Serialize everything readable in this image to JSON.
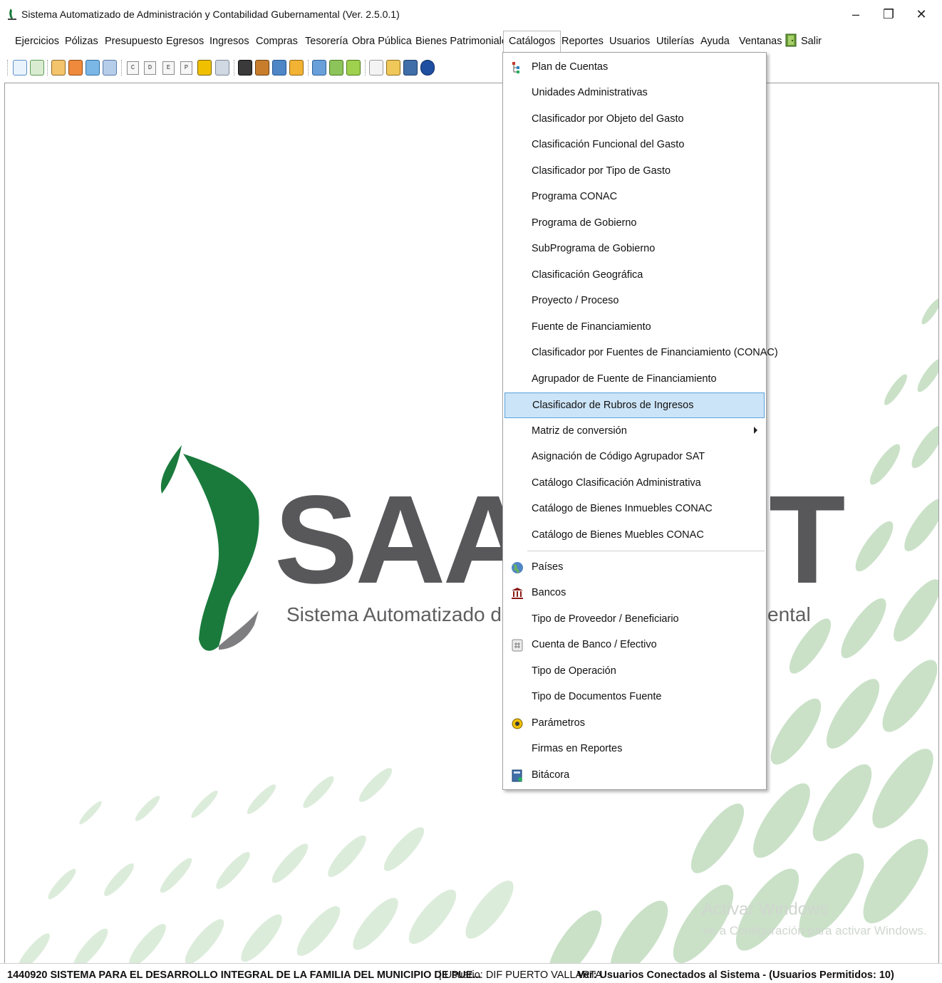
{
  "window": {
    "title": "Sistema Automatizado de Administración y Contabilidad Gubernamental  (Ver. 2.5.0.1)",
    "controls": {
      "minimize": "–",
      "maximize": "❐",
      "close": "✕"
    }
  },
  "menubar": {
    "items": [
      "Ejercicios",
      "Pólizas",
      "Presupuesto",
      "Egresos",
      "Ingresos",
      "Compras",
      "Tesorería",
      "Obra Pública",
      "Bienes Patrimoniales",
      "Catálogos",
      "Reportes",
      "Usuarios",
      "Utilerías",
      "Ayuda",
      "Ventanas",
      "Salir"
    ],
    "open_menu": "Catálogos"
  },
  "toolbar": {
    "letter_buttons": [
      "C",
      "D",
      "E",
      "P"
    ]
  },
  "catalogos_menu": {
    "items": [
      "Plan de Cuentas",
      "Unidades Administrativas",
      "Clasificador por Objeto del Gasto",
      "Clasificación Funcional del Gasto",
      "Clasificador por Tipo de Gasto",
      "Programa CONAC",
      "Programa de Gobierno",
      "SubPrograma de Gobierno",
      "Clasificación Geográfica",
      "Proyecto / Proceso",
      "Fuente de Financiamiento",
      "Clasificador por Fuentes de Financiamiento (CONAC)",
      "Agrupador de Fuente de Financiamiento",
      "Clasificador de Rubros de Ingresos",
      "Matriz de conversión",
      "Asignación de Código Agrupador SAT",
      "Catálogo Clasificación Administrativa",
      "Catálogo de Bienes Inmuebles CONAC",
      "Catálogo de Bienes Muebles CONAC",
      "Países",
      "Bancos",
      "Tipo de Proveedor / Beneficiario",
      "Cuenta de Banco / Efectivo",
      "Tipo de Operación",
      "Tipo de Documentos Fuente",
      "Parámetros",
      "Firmas en Reportes",
      "Bitácora"
    ],
    "selected": "Clasificador de Rubros de Ingresos",
    "submenu_item": "Matriz de conversión",
    "highlight_color": "#cce4f7"
  },
  "splash": {
    "logo_text_left": "SAAC",
    "logo_text_right": "T",
    "subtitle_left": "Sistema Automatizado de Adm",
    "subtitle_right": "ental",
    "brand_green": "#1a7a3c"
  },
  "watermark": {
    "title": "Activar Windows",
    "subtitle": "Ve a Configuración para activar Windows."
  },
  "statusbar": {
    "entity": "1440920 SISTEMA PARA EL DESARROLLO INTEGRAL DE LA FAMILIA DEL MUNICIPIO DE PUE...",
    "user": "| Usuario: DIF PUERTO VALLARTA",
    "connected": "Ver: Usuarios Conectados al Sistema - (Usuarios Permitidos: 10)"
  }
}
